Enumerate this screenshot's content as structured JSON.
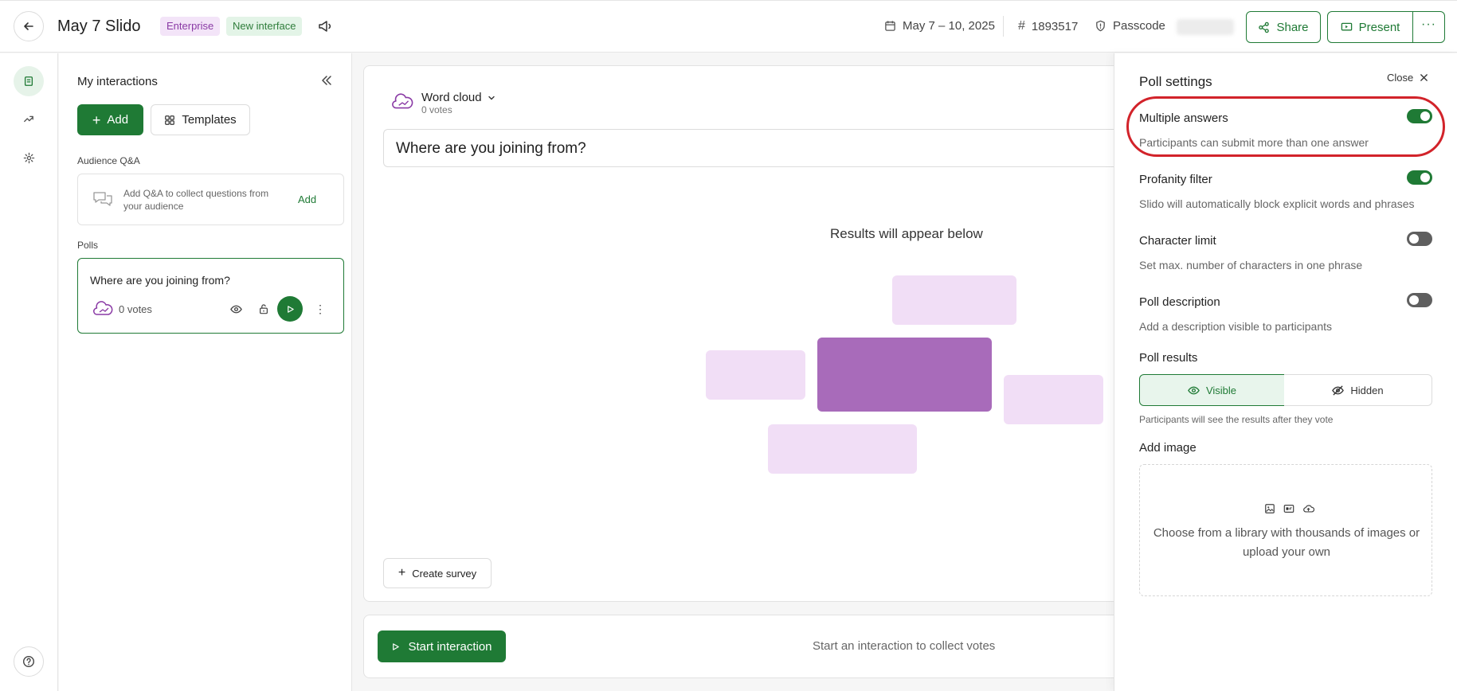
{
  "header": {
    "event_title": "May 7 Slido",
    "badge_enterprise": "Enterprise",
    "badge_new_interface": "New interface",
    "dates": "May 7 – 10, 2025",
    "event_code": "1893517",
    "passcode_label": "Passcode",
    "share_label": "Share",
    "present_label": "Present"
  },
  "interactions": {
    "title": "My interactions",
    "add_label": "Add",
    "templates_label": "Templates",
    "qa_section": "Audience Q&A",
    "qa_text": "Add Q&A to collect questions from your audience",
    "qa_add": "Add",
    "polls_section": "Polls",
    "poll_question": "Where are you joining from?",
    "poll_votes": "0 votes"
  },
  "main": {
    "poll_type": "Word cloud",
    "votes": "0 votes",
    "question": "Where are you joining from?",
    "results_placeholder": "Results will appear below",
    "create_survey": "Create survey",
    "start_interaction": "Start interaction",
    "footer_hint": "Start an interaction to collect votes"
  },
  "settings": {
    "title": "Poll settings",
    "close_label": "Close",
    "options": [
      {
        "title": "Multiple answers",
        "desc": "Participants can submit more than one answer",
        "enabled": true
      },
      {
        "title": "Profanity filter",
        "desc": "Slido will automatically block explicit words and phrases",
        "enabled": true
      },
      {
        "title": "Character limit",
        "desc": "Set max. number of characters in one phrase",
        "enabled": false
      },
      {
        "title": "Poll description",
        "desc": "Add a description visible to participants",
        "enabled": false
      }
    ],
    "results_title": "Poll results",
    "visible_label": "Visible",
    "hidden_label": "Hidden",
    "results_note": "Participants will see the results after they vote",
    "add_image_title": "Add image",
    "add_image_text": "Choose from a library with thousands of images or upload your own"
  },
  "colors": {
    "brand_green": "#1f7a35",
    "cloud_dark": "#a86bba",
    "cloud_light": "#f1def6",
    "highlight_red": "#d2232a"
  }
}
